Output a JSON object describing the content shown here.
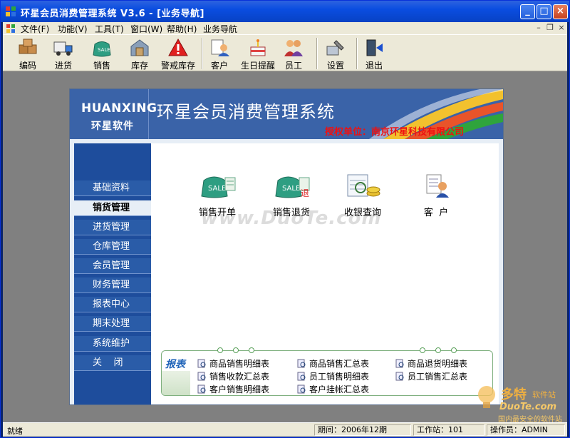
{
  "window": {
    "title": "环星会员消费管理系统 V3.6 - [业务导航]",
    "controls": [
      "minimize",
      "maximize",
      "close"
    ]
  },
  "menubar": {
    "items": [
      {
        "label": "文件(F)"
      },
      {
        "label": "功能(V)"
      },
      {
        "label": "工具(T)"
      },
      {
        "label": "窗口(W)"
      },
      {
        "label": "帮助(H)"
      },
      {
        "label": "业务导航"
      }
    ]
  },
  "toolbar": {
    "buttons": [
      {
        "label": "编码",
        "icon": "boxes-icon"
      },
      {
        "label": "进货",
        "icon": "truck-icon"
      },
      {
        "label": "销售",
        "icon": "sale-bag-icon"
      },
      {
        "label": "库存",
        "icon": "warehouse-icon"
      },
      {
        "label": "警戒库存",
        "icon": "warning-icon"
      },
      {
        "label": "客户",
        "icon": "customer-icon"
      },
      {
        "label": "生日提醒",
        "icon": "birthday-icon"
      },
      {
        "label": "员工",
        "icon": "staff-icon"
      },
      {
        "label": "设置",
        "icon": "settings-icon"
      },
      {
        "label": "退出",
        "icon": "exit-icon"
      }
    ]
  },
  "banner": {
    "english_name": "HUANXING",
    "company_short": "环星软件",
    "system_name": "环星会员消费管理系统",
    "authorized": "授权单位：南京环星科技有限公司"
  },
  "nav": {
    "items": [
      {
        "label": "基础资料",
        "active": false
      },
      {
        "label": "销货管理",
        "active": true
      },
      {
        "label": "进货管理",
        "active": false
      },
      {
        "label": "仓库管理",
        "active": false
      },
      {
        "label": "会员管理",
        "active": false
      },
      {
        "label": "财务管理",
        "active": false
      },
      {
        "label": "报表中心",
        "active": false
      },
      {
        "label": "期末处理",
        "active": false
      },
      {
        "label": "系统维护",
        "active": false
      },
      {
        "label": "关    闭",
        "active": false
      }
    ]
  },
  "functions": [
    {
      "label": "销售开单",
      "icon": "sale-open-icon"
    },
    {
      "label": "销售退货",
      "icon": "sale-return-icon"
    },
    {
      "label": "收银查询",
      "icon": "cash-query-icon"
    },
    {
      "label": "客  户",
      "icon": "customer-card-icon"
    }
  ],
  "watermark": "www.DuoTe.com",
  "reports": {
    "title": "报表",
    "links": [
      {
        "label": "商品销售明细表"
      },
      {
        "label": "商品销售汇总表"
      },
      {
        "label": "商品退货明细表"
      },
      {
        "label": "销售收款汇总表"
      },
      {
        "label": "员工销售明细表"
      },
      {
        "label": "员工销售汇总表"
      },
      {
        "label": "客户销售明细表"
      },
      {
        "label": "客户挂帐汇总表"
      }
    ]
  },
  "statusbar": {
    "ready": "就绪",
    "period": "期间：2006年12期",
    "workstation": "工作站：101",
    "operator": "操作员：ADMIN"
  },
  "corner_watermark": {
    "brand": "多特",
    "suffix": "软件站",
    "domain": "DuoTe.com",
    "slogan": "国内最安全的软件站"
  },
  "colors": {
    "titlebar": "#0a4de0",
    "banner": "#3a63a8",
    "nav": "#2a5ca8",
    "authorized_text": "#ee1111",
    "report_title": "#1e62b8"
  }
}
